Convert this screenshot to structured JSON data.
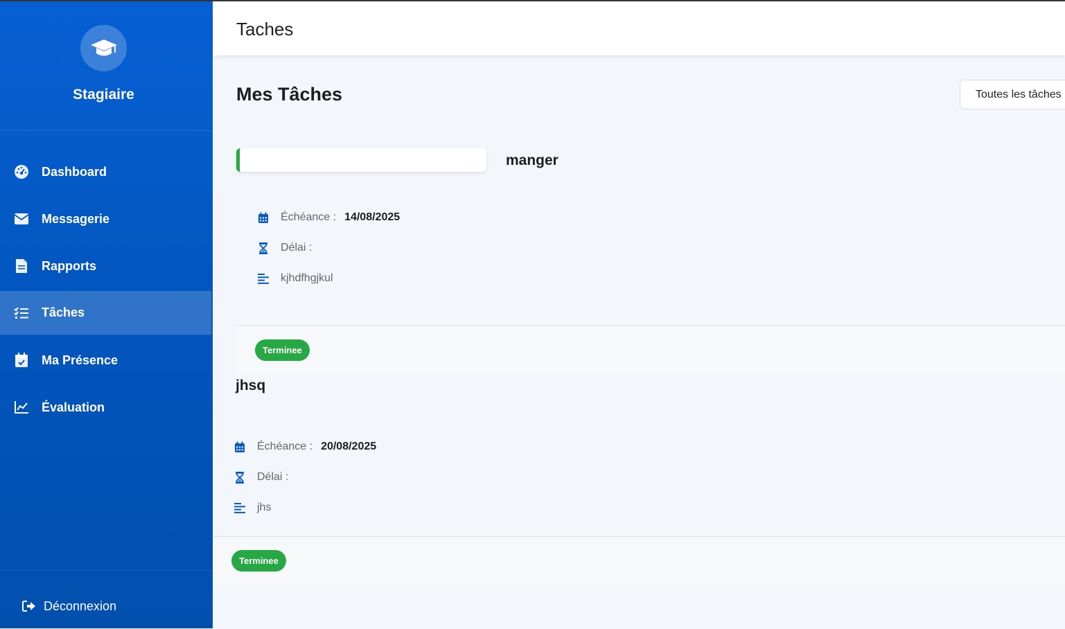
{
  "header": {
    "title": "Taches"
  },
  "sidebar": {
    "brand": "Stagiaire",
    "items": [
      {
        "label": "Dashboard",
        "icon": "dashboard-icon"
      },
      {
        "label": "Messagerie",
        "icon": "envelope-icon"
      },
      {
        "label": "Rapports",
        "icon": "document-icon"
      },
      {
        "label": "Tâches",
        "icon": "task-list-icon",
        "active": true
      },
      {
        "label": "Ma Présence",
        "icon": "calendar-check-icon"
      },
      {
        "label": "Évaluation",
        "icon": "line-chart-icon"
      }
    ],
    "logout": "Déconnexion"
  },
  "main": {
    "title": "Mes Tâches",
    "filter": "Toutes les tâches",
    "tasks": [
      {
        "title": "manger",
        "due_label": "Échéance :",
        "due_value": "14/08/2025",
        "delay_label": "Délai :",
        "description": "kjhdfhgjkul",
        "status": "Terminee"
      },
      {
        "title": "jhsq",
        "due_label": "Échéance :",
        "due_value": "20/08/2025",
        "delay_label": "Délai :",
        "description": "jhs",
        "status": "Terminee"
      }
    ]
  },
  "colors": {
    "sidebar": "#0356bf",
    "accent": "#0659c9",
    "success": "#28a745"
  }
}
